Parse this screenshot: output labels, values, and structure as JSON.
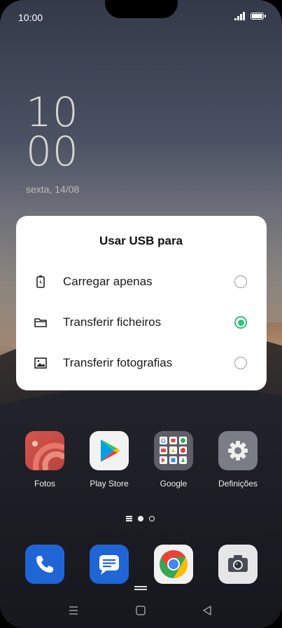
{
  "status_bar": {
    "time": "10:00",
    "icons": [
      "signal-icon",
      "battery-icon"
    ]
  },
  "lockscreen": {
    "clock_hours": "10",
    "clock_minutes": "00",
    "date": "sexta, 14/08"
  },
  "dialog": {
    "title": "Usar USB para",
    "options": [
      {
        "label": "Carregar apenas",
        "icon": "battery-charge-icon",
        "selected": false
      },
      {
        "label": "Transferir ficheiros",
        "icon": "folder-icon",
        "selected": true
      },
      {
        "label": "Transferir fotografias",
        "icon": "image-icon",
        "selected": false
      }
    ],
    "accent": "#2fc27a"
  },
  "apps": [
    {
      "label": "Fotos",
      "icon": "photos-icon"
    },
    {
      "label": "Play Store",
      "icon": "play-store-icon"
    },
    {
      "label": "Google",
      "icon": "google-folder-icon"
    },
    {
      "label": "Definições",
      "icon": "settings-icon"
    }
  ],
  "dock": [
    {
      "icon": "phone-icon"
    },
    {
      "icon": "messages-icon"
    },
    {
      "icon": "chrome-icon"
    },
    {
      "icon": "camera-icon"
    }
  ],
  "pager": {
    "pages": 2,
    "current": 1
  },
  "navigation": [
    "menu-icon",
    "home-icon",
    "back-icon"
  ]
}
